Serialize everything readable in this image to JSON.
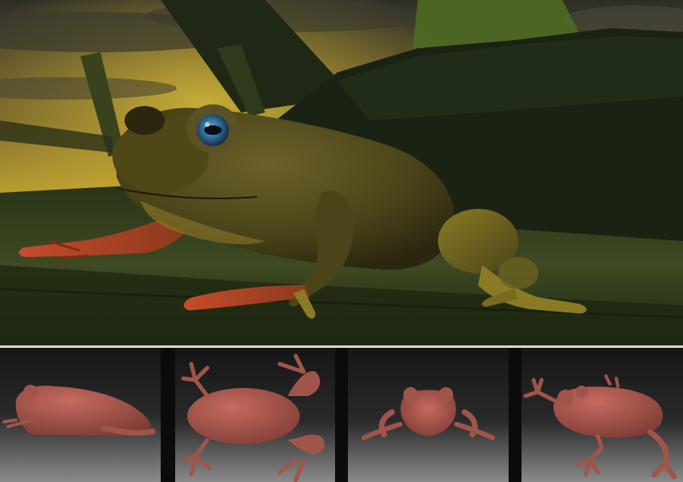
{
  "colors": {
    "sky_top": "#3a3a2a",
    "sky_glow": "#c9a733",
    "leaf_dark": "#1e2a18",
    "leaf_mid": "#3b4a24",
    "frog_body": "#5a5222",
    "frog_belly": "#8a7a2a",
    "frog_toe": "#c04a2a",
    "frog_eye": "#2f6a96",
    "clay": "#b05a50",
    "clay_shadow": "#6e3530",
    "thumb_floor_top": "#3a3a3a",
    "thumb_floor_bottom": "#9a9a9a",
    "divider": "#d8d8d8"
  },
  "images": [
    {
      "name": "rendered-frog-on-leaf",
      "kind": "render"
    },
    {
      "name": "clay-frog-side-view",
      "kind": "sculpt"
    },
    {
      "name": "clay-frog-top-view",
      "kind": "sculpt"
    },
    {
      "name": "clay-frog-front-view",
      "kind": "sculpt"
    },
    {
      "name": "clay-frog-three-quarter-view",
      "kind": "sculpt"
    }
  ]
}
